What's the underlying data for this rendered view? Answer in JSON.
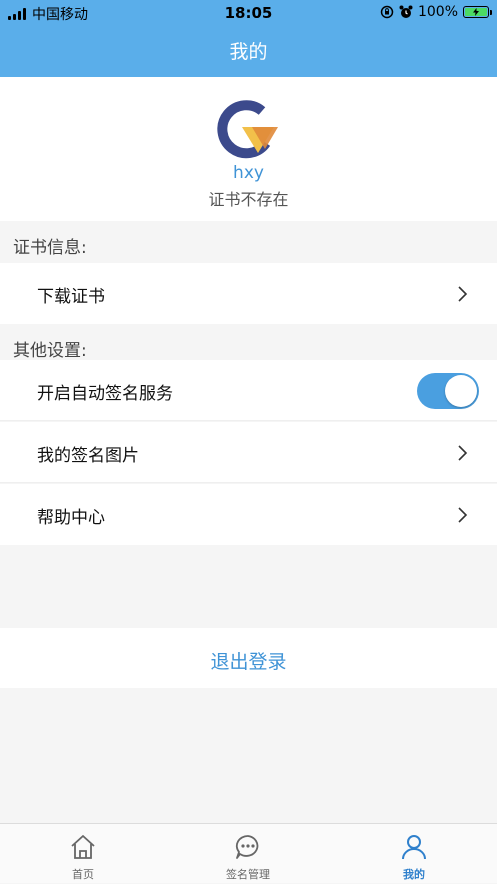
{
  "status_bar": {
    "carrier": "中国移动",
    "time": "18:05",
    "battery": "100%"
  },
  "header": {
    "title": "我的"
  },
  "profile": {
    "username": "hxy",
    "cert_status": "证书不存在"
  },
  "sections": {
    "cert_info_label": "证书信息:",
    "other_settings_label": "其他设置:"
  },
  "rows": {
    "download_cert": "下载证书",
    "auto_sign": "开启自动签名服务",
    "auto_sign_enabled": true,
    "signature_images": "我的签名图片",
    "help_center": "帮助中心"
  },
  "logout": {
    "label": "退出登录"
  },
  "tabbar": {
    "tabs": [
      {
        "label": "首页",
        "icon": "home-icon"
      },
      {
        "label": "签名管理",
        "icon": "chat-icon"
      },
      {
        "label": "我的",
        "icon": "user-icon",
        "active": true
      }
    ]
  },
  "colors": {
    "header": "#5aaeea",
    "accent": "#3f93d6",
    "toggle_on": "#4a9fe0"
  }
}
